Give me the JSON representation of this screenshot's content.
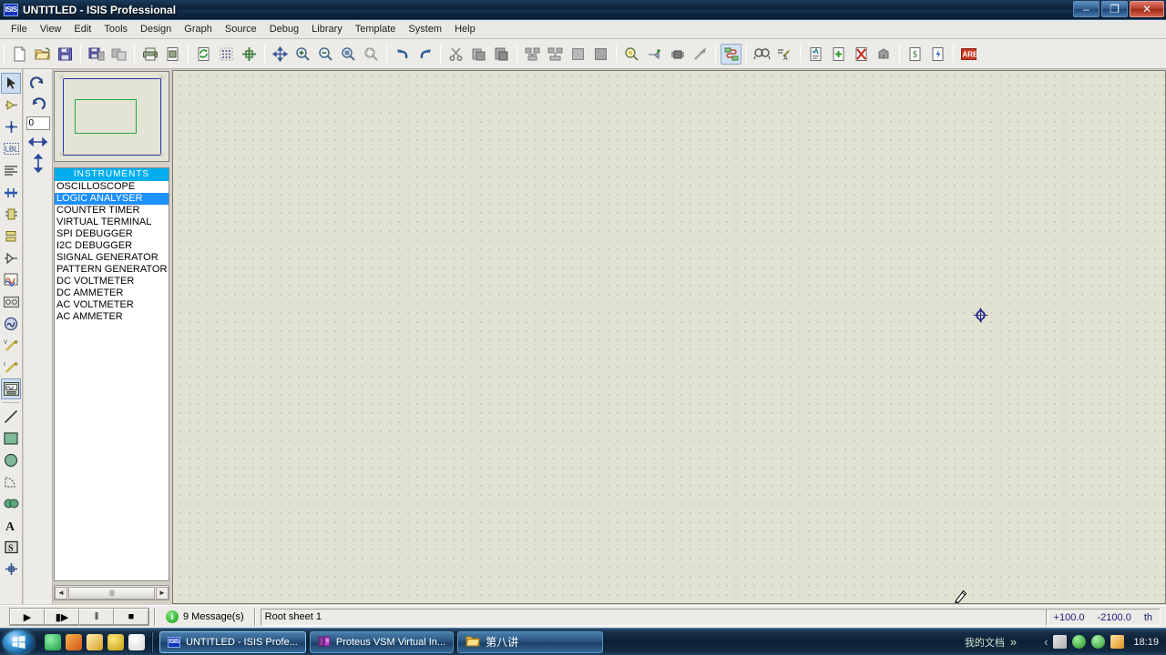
{
  "window": {
    "title": "UNTITLED - ISIS Professional",
    "app_icon": "isis-icon",
    "minimize": "–",
    "restore": "❐",
    "close": "✕"
  },
  "menubar": {
    "items": [
      {
        "label": "File"
      },
      {
        "label": "View"
      },
      {
        "label": "Edit"
      },
      {
        "label": "Tools"
      },
      {
        "label": "Design"
      },
      {
        "label": "Graph"
      },
      {
        "label": "Source"
      },
      {
        "label": "Debug"
      },
      {
        "label": "Library"
      },
      {
        "label": "Template"
      },
      {
        "label": "System"
      },
      {
        "label": "Help"
      }
    ]
  },
  "toolbar": {
    "groups": [
      [
        "new-file-icon",
        "open-file-icon",
        "save-file-icon"
      ],
      [
        "import-section-icon",
        "export-section-icon"
      ],
      [
        "print-icon",
        "print-area-icon"
      ],
      [
        "refresh-display-icon",
        "toggle-grid-icon",
        "origin-icon"
      ],
      [
        "pan-icon",
        "zoom-in-icon",
        "zoom-out-icon",
        "zoom-all-icon",
        "zoom-area-icon"
      ],
      [
        "undo-icon",
        "redo-icon"
      ],
      [
        "cut-icon",
        "copy-icon",
        "paste-icon"
      ],
      [
        "block-copy-icon",
        "block-move-icon",
        "block-rotate-icon",
        "block-delete-icon"
      ],
      [
        "pick-device-icon",
        "make-device-icon",
        "packaging-tool-icon",
        "decompose-icon"
      ],
      [
        "wire-autorouter-icon"
      ],
      [
        "search-tag-icon",
        "property-assignment-icon"
      ],
      [
        "design-explorer-icon",
        "new-sheet-icon",
        "remove-sheet-icon",
        "exit-sheet-icon"
      ],
      [
        "bill-of-materials-icon",
        "electrical-rules-check-icon"
      ],
      [
        "netlist-to-ares-icon"
      ]
    ]
  },
  "modebar": {
    "items": [
      {
        "name": "selection-mode",
        "selected": true
      },
      {
        "name": "component-mode",
        "selected": false
      },
      {
        "name": "junction-dot-mode",
        "selected": false
      },
      {
        "name": "wire-label-mode",
        "selected": false
      },
      {
        "name": "text-script-mode",
        "selected": false
      },
      {
        "name": "bus-mode",
        "selected": false
      },
      {
        "name": "subcircuit-mode",
        "selected": false
      },
      {
        "name": "terminals-mode",
        "selected": false
      },
      {
        "name": "device-pins-mode",
        "selected": false
      },
      {
        "name": "graph-mode",
        "selected": false
      },
      {
        "name": "tape-recorder-mode",
        "selected": false
      },
      {
        "name": "generator-mode",
        "selected": false
      },
      {
        "name": "voltage-probe-mode",
        "selected": false
      },
      {
        "name": "current-probe-mode",
        "selected": false
      },
      {
        "name": "virtual-instruments-mode",
        "selected": true
      },
      {
        "name": "line-tool",
        "selected": false
      },
      {
        "name": "box-tool",
        "selected": false
      },
      {
        "name": "circle-tool",
        "selected": false
      },
      {
        "name": "arc-tool",
        "selected": false
      },
      {
        "name": "path-tool",
        "selected": false
      },
      {
        "name": "text-tool",
        "selected": false
      },
      {
        "name": "symbol-tool",
        "selected": false
      },
      {
        "name": "marker-tool",
        "selected": false
      }
    ]
  },
  "orientation": {
    "rotate_cw": "rotate-clockwise-icon",
    "rotate_ccw": "rotate-counterclockwise-icon",
    "angle_value": "0",
    "mirror_x": "mirror-horizontal-icon",
    "mirror_y": "mirror-vertical-icon"
  },
  "overview": {
    "label": "overview-panel"
  },
  "picker": {
    "header": "INSTRUMENTS",
    "items": [
      {
        "label": "OSCILLOSCOPE",
        "selected": false
      },
      {
        "label": "LOGIC ANALYSER",
        "selected": true
      },
      {
        "label": "COUNTER TIMER",
        "selected": false
      },
      {
        "label": "VIRTUAL TERMINAL",
        "selected": false
      },
      {
        "label": "SPI DEBUGGER",
        "selected": false
      },
      {
        "label": "I2C DEBUGGER",
        "selected": false
      },
      {
        "label": "SIGNAL GENERATOR",
        "selected": false
      },
      {
        "label": "PATTERN GENERATOR",
        "selected": false
      },
      {
        "label": "DC VOLTMETER",
        "selected": false
      },
      {
        "label": "DC AMMETER",
        "selected": false
      },
      {
        "label": "AC VOLTMETER",
        "selected": false
      },
      {
        "label": "AC AMMETER",
        "selected": false
      }
    ],
    "scroll_left": "◄",
    "scroll_right": "►",
    "scroll_grip": "‖‖"
  },
  "canvas": {
    "origin_marker": "origin-crosshair-marker",
    "cursor": "pencil-cursor"
  },
  "statusbar": {
    "animation": [
      {
        "name": "play-button",
        "glyph": "▶"
      },
      {
        "name": "step-button",
        "glyph": "▮▶"
      },
      {
        "name": "pause-button",
        "glyph": "‖"
      },
      {
        "name": "stop-button",
        "glyph": "■"
      }
    ],
    "message_count": "9 Message(s)",
    "info_glyph": "i",
    "sheet": "Root sheet 1",
    "coord_x": "+100.0",
    "coord_y": "-2100.0",
    "coord_units": "th"
  },
  "taskbar": {
    "start": "windows-start-orb",
    "quicklaunch": [
      {
        "name": "messenger-icon",
        "color": "#35c45a"
      },
      {
        "name": "media-player-icon",
        "color": "#e8762a"
      },
      {
        "name": "download-manager-icon",
        "color": "#f0c020"
      },
      {
        "name": "yellow-app-icon",
        "color": "#d8b018"
      },
      {
        "name": "qq-penguin-icon",
        "color": "#e8e8e8"
      }
    ],
    "tasks": [
      {
        "label": "UNTITLED - ISIS Profe...",
        "icon": "isis-icon",
        "active": true
      },
      {
        "label": "Proteus VSM Virtual In...",
        "icon": "book-icon",
        "active": false
      },
      {
        "label": "第八讲",
        "icon": "folder-icon",
        "active": false
      }
    ],
    "tray_label": "我的文档",
    "tray_expand": "»",
    "tray_chevron": "‹",
    "tray_icons": [
      {
        "name": "safety-guard-icon",
        "color": "#d86040"
      },
      {
        "name": "shield-green-icon",
        "color": "#3aa83a"
      },
      {
        "name": "update-icon",
        "color": "#36a836"
      },
      {
        "name": "folder-tray-icon",
        "color": "#e8a828"
      }
    ],
    "clock": "18:19"
  }
}
